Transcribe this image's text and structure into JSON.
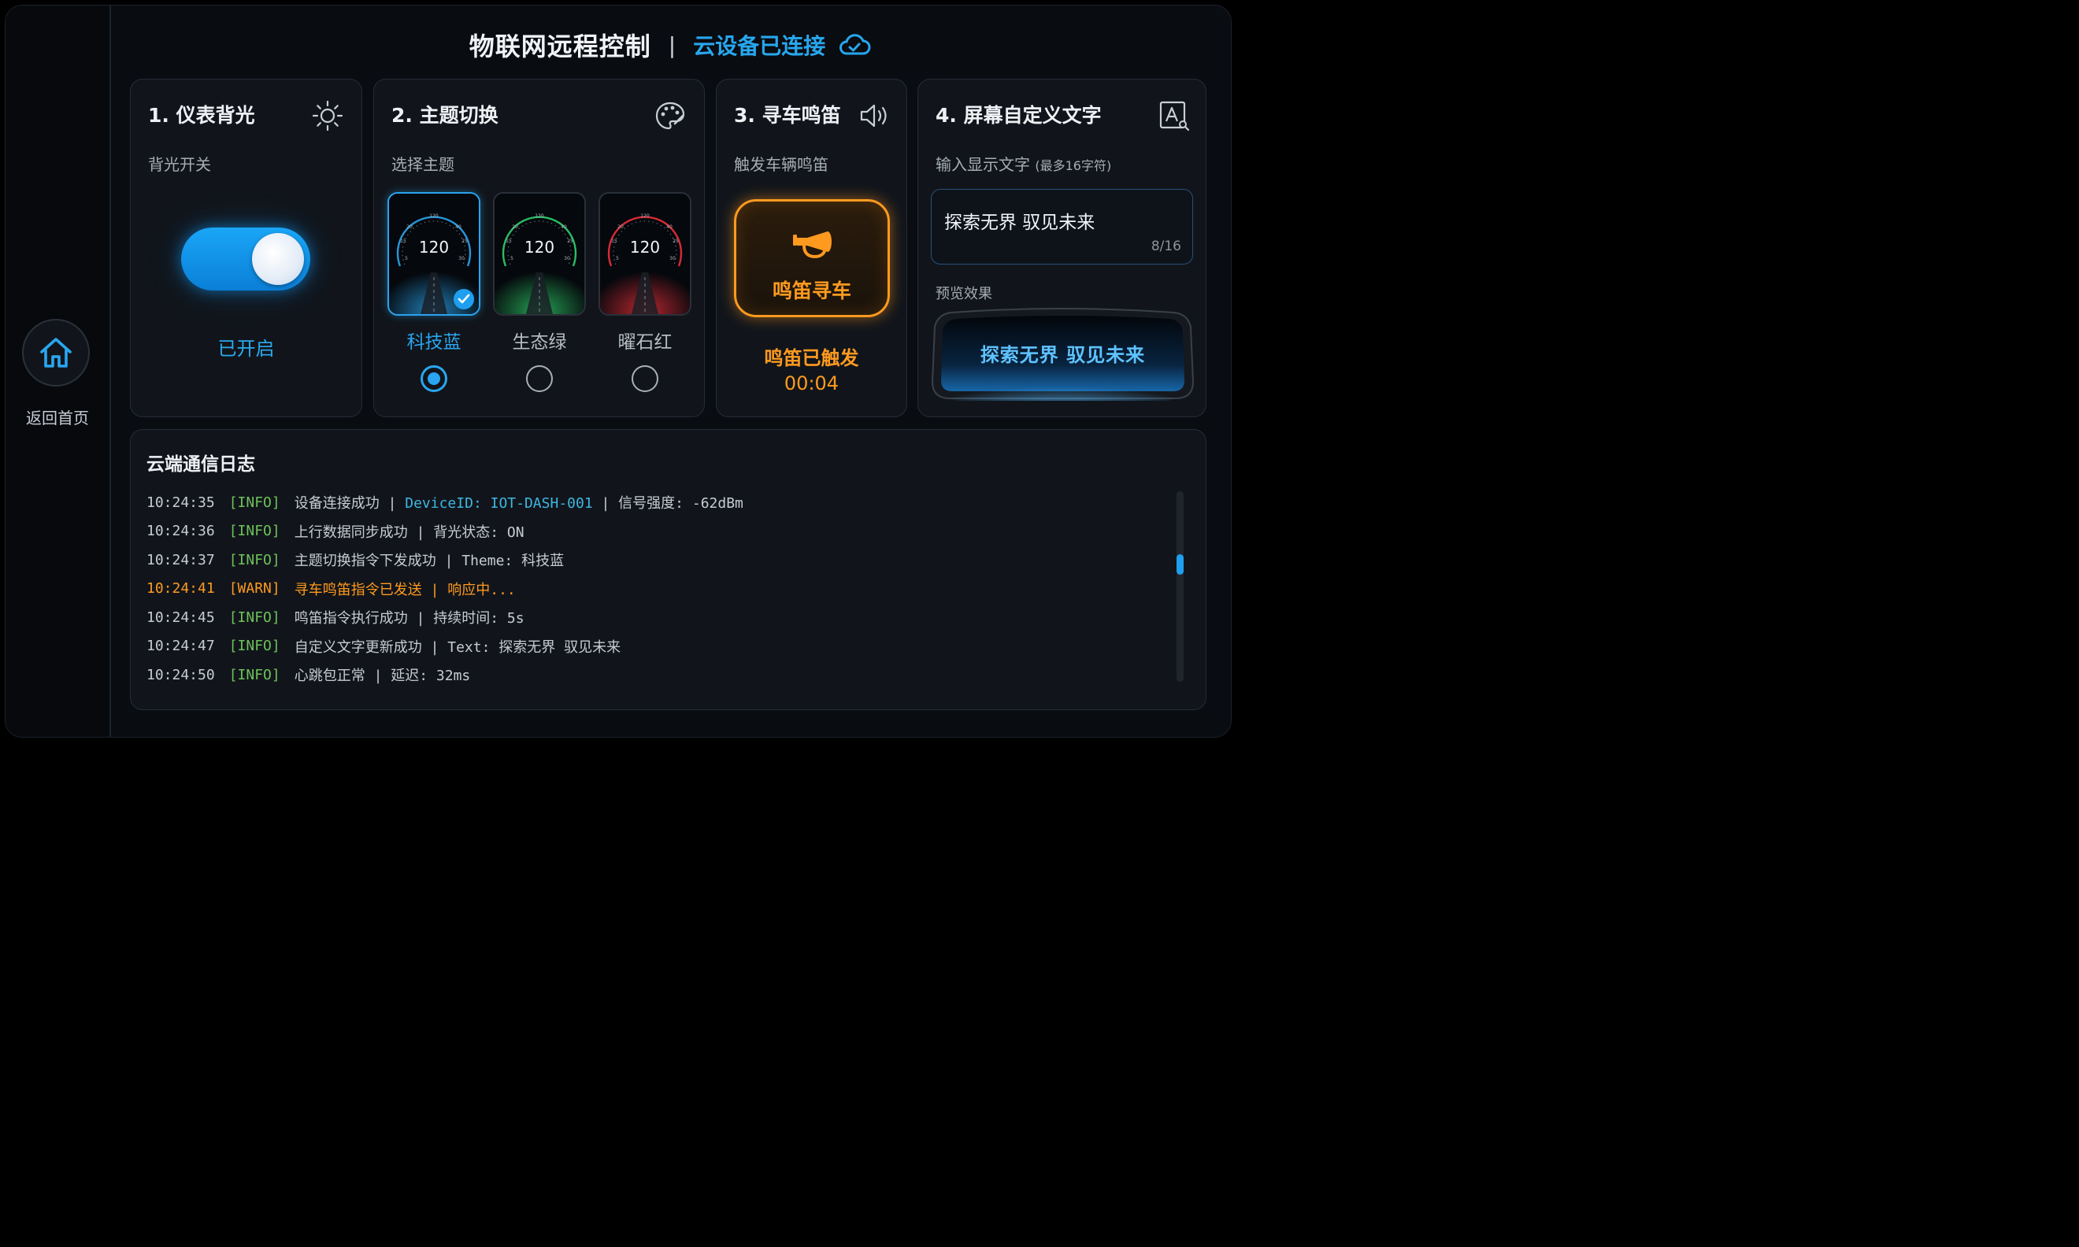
{
  "header": {
    "title": "物联网远程控制",
    "separator": "|",
    "status": "云设备已连接"
  },
  "nav": {
    "home_label": "返回首页"
  },
  "backlight": {
    "title": "1. 仪表背光",
    "subtitle": "背光开关",
    "state": "已开启",
    "enabled": true
  },
  "theme": {
    "title": "2. 主题切换",
    "subtitle": "选择主题",
    "speed": "120",
    "options": [
      {
        "label": "科技蓝",
        "color": "#2aa6f0",
        "selected": true
      },
      {
        "label": "生态绿",
        "color": "#2fd36b",
        "selected": false
      },
      {
        "label": "曜石红",
        "color": "#f0303a",
        "selected": false
      }
    ]
  },
  "horn": {
    "title": "3. 寻车鸣笛",
    "subtitle": "触发车辆鸣笛",
    "button_label": "鸣笛寻车",
    "status": "鸣笛已触发",
    "timer": "00:04"
  },
  "custom_text": {
    "title": "4. 屏幕自定义文字",
    "subtitle": "输入显示文字",
    "subtitle_hint": "(最多16字符)",
    "value": "探索无界  驭见未来",
    "count": "8/16",
    "preview_label": "预览效果",
    "preview_text": "探索无界  驭见未来"
  },
  "log": {
    "title": "云端通信日志",
    "entries": [
      {
        "time": "10:24:35",
        "level": "[INFO]",
        "pre": "设备连接成功 | ",
        "hl": "DeviceID: IOT-DASH-001",
        "post": " | 信号强度: -62dBm",
        "warn": false
      },
      {
        "time": "10:24:36",
        "level": "[INFO]",
        "pre": "上行数据同步成功 | 背光状态: ON",
        "hl": "",
        "post": "",
        "warn": false
      },
      {
        "time": "10:24:37",
        "level": "[INFO]",
        "pre": "主题切换指令下发成功 | Theme: 科技蓝",
        "hl": "",
        "post": "",
        "warn": false
      },
      {
        "time": "10:24:41",
        "level": "[WARN]",
        "pre": "寻车鸣笛指令已发送 | 响应中...",
        "hl": "",
        "post": "",
        "warn": true
      },
      {
        "time": "10:24:45",
        "level": "[INFO]",
        "pre": "鸣笛指令执行成功 | 持续时间: 5s",
        "hl": "",
        "post": "",
        "warn": false
      },
      {
        "time": "10:24:47",
        "level": "[INFO]",
        "pre": "自定义文字更新成功 | Text: 探索无界 驭见未来",
        "hl": "",
        "post": "",
        "warn": false
      },
      {
        "time": "10:24:50",
        "level": "[INFO]",
        "pre": "心跳包正常 | 延迟: 32ms",
        "hl": "",
        "post": "",
        "warn": false
      }
    ]
  },
  "colors": {
    "accent": "#1f9ff0",
    "warn": "#ff9a1f",
    "ok": "#6ec15a"
  },
  "icons": [
    "home-icon",
    "cloud-check-icon",
    "sun-icon",
    "palette-icon",
    "speaker-icon",
    "text-search-icon",
    "horn-icon",
    "check-icon"
  ]
}
